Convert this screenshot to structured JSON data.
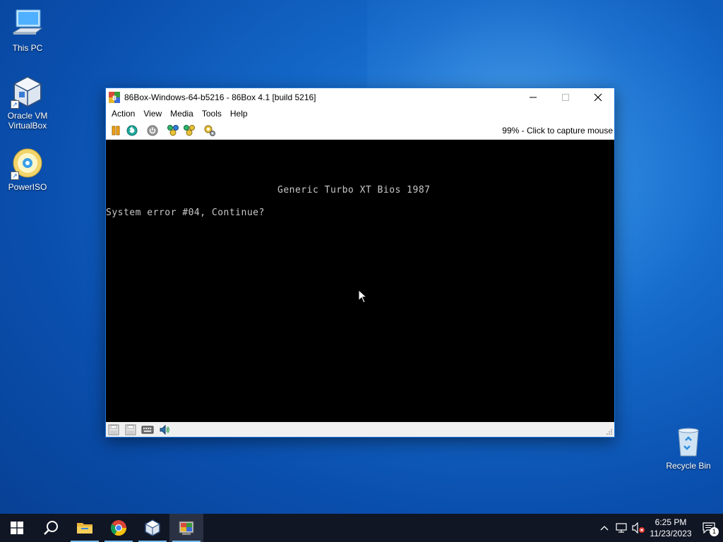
{
  "desktop": {
    "icons": [
      {
        "label": "This PC",
        "icon": "computer-icon"
      },
      {
        "label": "Oracle VM VirtualBox",
        "icon": "virtualbox-icon"
      },
      {
        "label": "PowerISO",
        "icon": "poweriso-icon"
      },
      {
        "label": "Recycle Bin",
        "icon": "recycle-bin-icon"
      }
    ]
  },
  "window": {
    "title": "86Box-Windows-64-b5216 - 86Box 4.1 [build 5216]",
    "controls": {
      "minimize": "minimize-icon",
      "maximize": "maximize-icon",
      "close": "close-icon"
    },
    "menu": [
      "Action",
      "View",
      "Media",
      "Tools",
      "Help"
    ],
    "toolbar": {
      "buttons": [
        "pause-icon",
        "reset-icon",
        "power-icon",
        "ctrl-alt-del-icon",
        "ctrl-alt-esc-icon",
        "settings-icon"
      ],
      "status": "99% - Click to capture mouse"
    },
    "screen": {
      "lines": [
        "Generic Turbo XT Bios 1987",
        "System error #04, Continue?"
      ]
    },
    "statusbar": [
      "floppy-a-icon",
      "floppy-b-icon",
      "keyboard-icon",
      "sound-icon"
    ]
  },
  "taskbar": {
    "apps": [
      "start-icon",
      "search-icon",
      "file-explorer-icon",
      "chrome-icon",
      "virtualbox-icon",
      "86box-icon"
    ],
    "tray": [
      "show-hidden-icons-icon",
      "network-icon",
      "volume-muted-icon"
    ],
    "time": "6:25 PM",
    "date": "11/23/2023",
    "notifications": "1"
  },
  "colors": {
    "accent": "#1e73d6",
    "taskbar": "#101624",
    "screen": "#000000",
    "bios_text": "#c8c8c8"
  }
}
